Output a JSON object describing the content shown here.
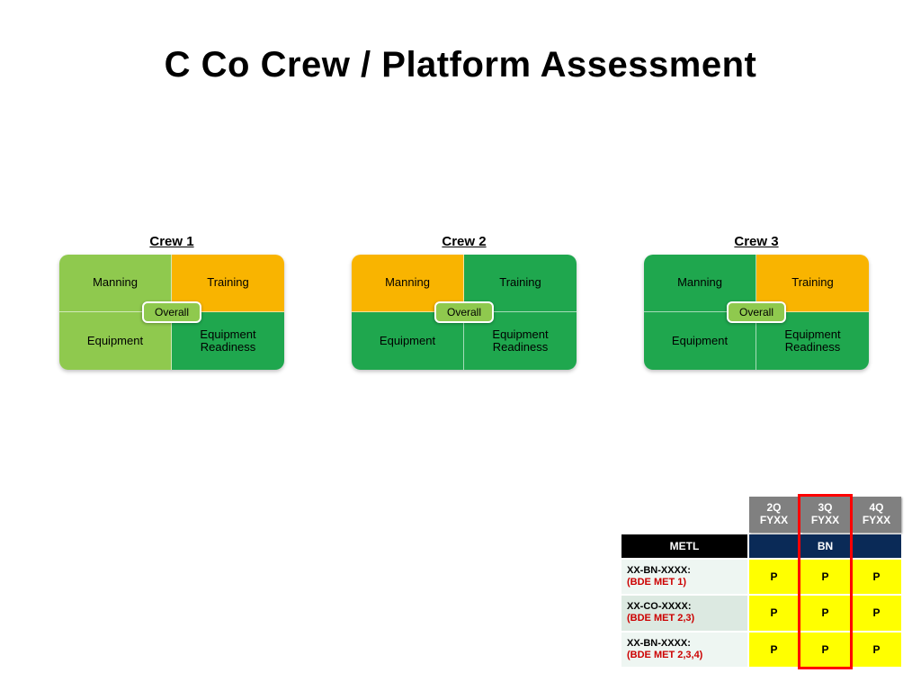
{
  "title": "C Co Crew / Platform Assessment",
  "colors": {
    "lightGreen": "#8fc94e",
    "green": "#1fa74e",
    "orange": "#f9b400"
  },
  "crews": [
    {
      "label": "Crew 1",
      "overall": {
        "text": "Overall",
        "color": "lightGreen"
      },
      "cells": {
        "tl": {
          "text": "Manning",
          "color": "lightGreen"
        },
        "tr": {
          "text": "Training",
          "color": "orange"
        },
        "bl": {
          "text": "Equipment",
          "color": "lightGreen"
        },
        "br": {
          "text": "Equipment\nReadiness",
          "color": "green"
        }
      }
    },
    {
      "label": "Crew 2",
      "overall": {
        "text": "Overall",
        "color": "lightGreen"
      },
      "cells": {
        "tl": {
          "text": "Manning",
          "color": "orange"
        },
        "tr": {
          "text": "Training",
          "color": "green"
        },
        "bl": {
          "text": "Equipment",
          "color": "green"
        },
        "br": {
          "text": "Equipment\nReadiness",
          "color": "green"
        }
      }
    },
    {
      "label": "Crew 3",
      "overall": {
        "text": "Overall",
        "color": "lightGreen"
      },
      "cells": {
        "tl": {
          "text": "Manning",
          "color": "green"
        },
        "tr": {
          "text": "Training",
          "color": "orange"
        },
        "bl": {
          "text": "Equipment",
          "color": "green"
        },
        "br": {
          "text": "Equipment\nReadiness",
          "color": "green"
        }
      }
    }
  ],
  "metl": {
    "quarters": [
      "2Q\nFYXX",
      "3Q\nFYXX",
      "4Q\nFYXX"
    ],
    "rowHeaderTitle": "METL",
    "bnLabel": "BN",
    "highlightQuarterIndex": 1,
    "rows": [
      {
        "main": "XX-BN-XXXX:",
        "sub": "(BDE MET 1)",
        "vals": [
          "P",
          "P",
          "P"
        ]
      },
      {
        "main": "XX-CO-XXXX:",
        "sub": "(BDE MET 2,3)",
        "vals": [
          "P",
          "P",
          "P"
        ]
      },
      {
        "main": "XX-BN-XXXX:",
        "sub": "(BDE MET 2,3,4)",
        "vals": [
          "P",
          "P",
          "P"
        ]
      }
    ]
  }
}
